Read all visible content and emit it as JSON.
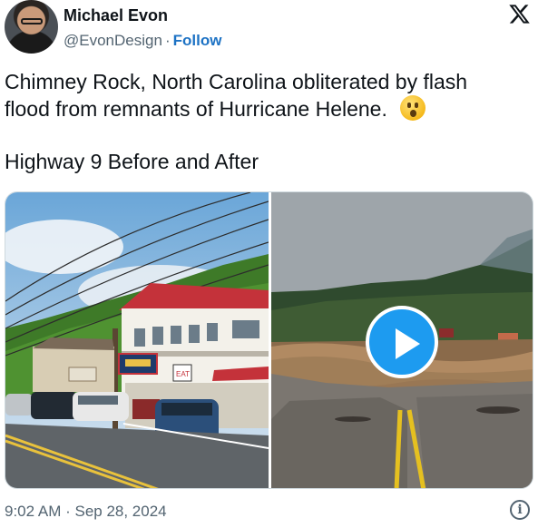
{
  "author": {
    "name": "Michael Evon",
    "handle": "@EvonDesign",
    "separator": "·",
    "follow_label": "Follow",
    "avatar_icon": "user-avatar"
  },
  "brand": {
    "logo_icon": "x-logo-icon"
  },
  "tweet": {
    "line1": "Chimney Rock, North Carolina  obliterated by flash",
    "line2": "flood from remnants of Hurricane Helene.",
    "emoji_icon": "astonished-face-emoji",
    "line3": "Highway 9 Before and After"
  },
  "media": {
    "left_photo": "before-photo",
    "right_photo": "after-video",
    "play_icon": "play-icon",
    "store_sign": "EAT"
  },
  "footer": {
    "timestamp": "9:02 AM · Sep 28, 2024",
    "info_icon": "info-icon",
    "info_glyph": "i"
  },
  "colors": {
    "text": "#0f1419",
    "secondary": "#536471",
    "follow": "#1d72c4",
    "play": "#1d9bf0"
  }
}
